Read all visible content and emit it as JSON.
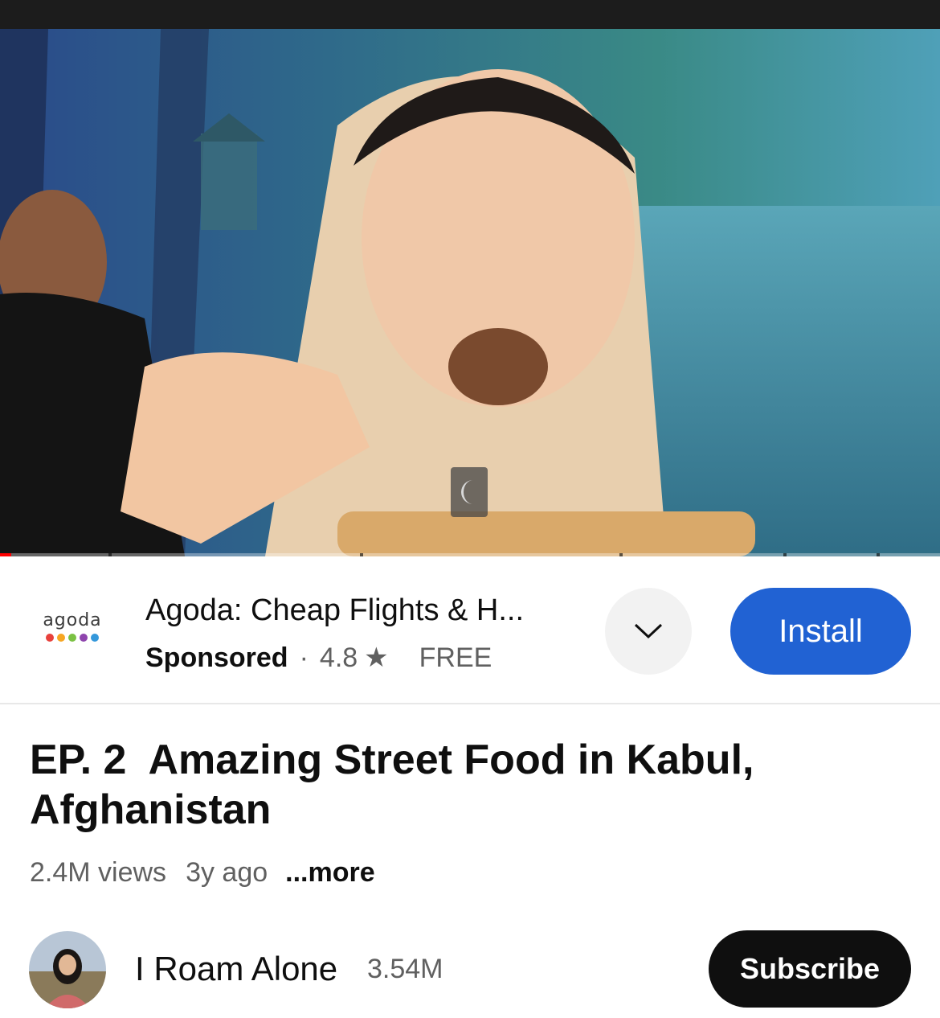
{
  "player": {
    "progress_played_fraction": 0.012
  },
  "ad": {
    "logo_text": "agoda",
    "logo_dot_colors": [
      "#e8413c",
      "#f6a623",
      "#7ac143",
      "#8e44ad",
      "#3498db"
    ],
    "title": "Agoda: Cheap Flights & H...",
    "sponsored_label": "Sponsored",
    "separator": "·",
    "rating": "4.8",
    "star_icon": "★",
    "price": "FREE",
    "chevron_icon": "chevron-down",
    "install_label": "Install"
  },
  "video": {
    "title": "EP. 2  Amazing Street Food in Kabul,\nAfghanistan",
    "views": "2.4M views",
    "age": "3y ago",
    "more_label": "...more"
  },
  "channel": {
    "name": "I Roam Alone",
    "subscribers": "3.54M",
    "subscribe_label": "Subscribe"
  },
  "colors": {
    "install_blue": "#2162d3",
    "subscribe_black": "#0f0f0f",
    "progress_red": "#ff0000"
  }
}
